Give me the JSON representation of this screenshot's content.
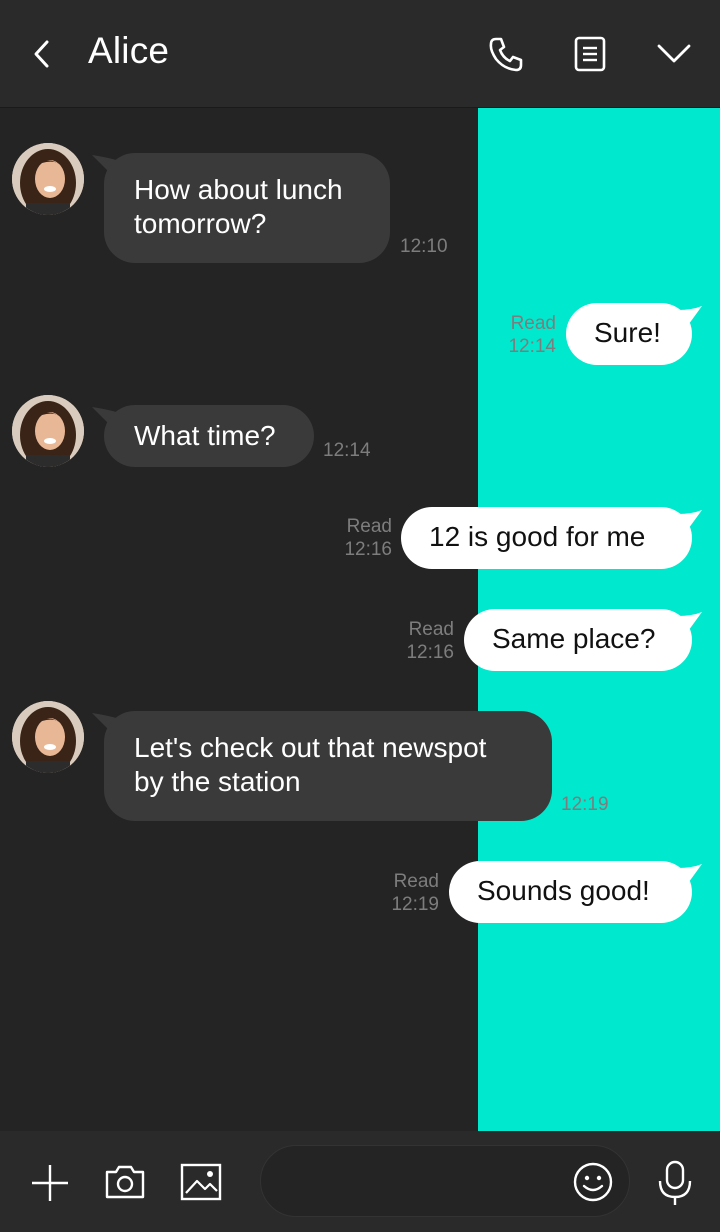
{
  "header": {
    "title": "Alice",
    "icons": [
      "back-icon",
      "phone-icon",
      "notes-icon",
      "chevron-down-icon"
    ]
  },
  "colors": {
    "background": "#242424",
    "accent": "#00e8cd",
    "incoming_bubble": "#3a3a3a",
    "outgoing_bubble": "#ffffff"
  },
  "messages": [
    {
      "direction": "in",
      "text_lines": [
        "How about lunch",
        "tomorrow?"
      ],
      "time": "12:10"
    },
    {
      "direction": "out",
      "text": "Sure!",
      "status": "Read",
      "time": "12:14"
    },
    {
      "direction": "in",
      "text": "What time?",
      "time": "12:14"
    },
    {
      "direction": "out",
      "text": "12 is good for me",
      "status": "Read",
      "time": "12:16"
    },
    {
      "direction": "out",
      "text": "Same place?",
      "status": "Read",
      "time": "12:16"
    },
    {
      "direction": "in",
      "text_lines": [
        "Let's check out that newspot",
        "by the station"
      ],
      "time": "12:19"
    },
    {
      "direction": "out",
      "text": "Sounds good!",
      "status": "Read",
      "time": "12:19"
    }
  ],
  "input_bar": {
    "icons": [
      "plus-icon",
      "camera-icon",
      "image-icon",
      "emoji-icon",
      "microphone-icon"
    ],
    "message_value": ""
  }
}
